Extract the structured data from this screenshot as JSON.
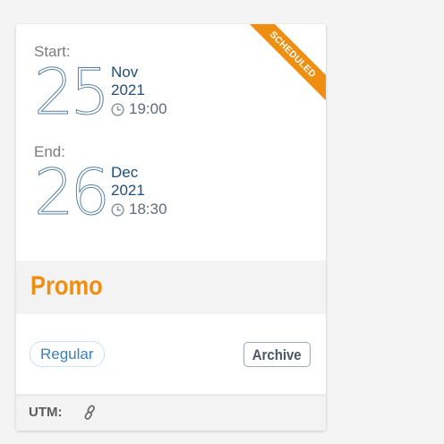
{
  "event": {
    "status_badge": "SCHEDULED",
    "start": {
      "label": "Start:",
      "day": "25",
      "month": "Nov",
      "year": "2021",
      "time": "19:00"
    },
    "end": {
      "label": "End:",
      "day": "26",
      "month": "Dec",
      "year": "2021",
      "time": "18:30"
    },
    "name": "Promo",
    "type": "Regular",
    "archive_label": "Archive",
    "utm_label": "UTM:"
  },
  "icons": {
    "clock": "clock-icon",
    "link": "link-icon"
  },
  "colors": {
    "accent": "#ee8f12",
    "date": "#3a6d95",
    "pill_text": "#3d82b6"
  }
}
